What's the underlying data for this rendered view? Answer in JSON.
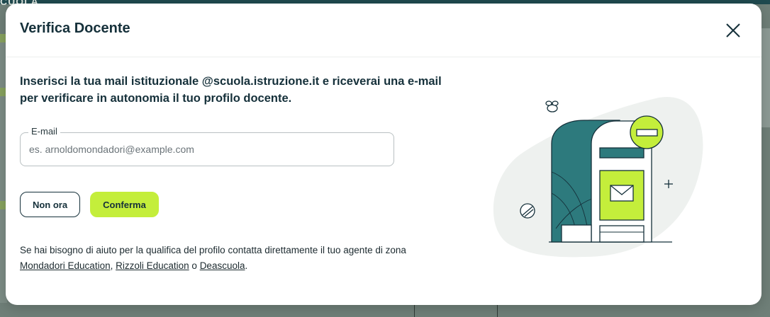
{
  "background": {
    "brand_text": "CUOLA"
  },
  "modal": {
    "title": "Verifica Docente",
    "intro": "Inserisci la tua mail istituzionale @scuola.istruzione.it e riceverai una e-mail per verificare in autonomia il tuo profilo docente.",
    "email_label": "E-mail",
    "email_placeholder": "es. arnoldomondadori@example.com",
    "email_value": "",
    "btn_cancel": "Non ora",
    "btn_confirm": "Conferma",
    "help_prefix": "Se hai bisogno di aiuto per la qualifica del profilo contatta direttamente il tuo agente di zona ",
    "help_link_1": "Mondadori Education",
    "help_sep_1": ", ",
    "help_link_2": "Rizzoli Education",
    "help_sep_2": " o ",
    "help_link_3": "Deascuola",
    "help_suffix": "."
  },
  "icons": {
    "close": "close-icon",
    "illustration": "mailbox-illustration"
  },
  "colors": {
    "accent": "#c4ee3b",
    "text_dark": "#15303a",
    "teal": "#2d7a7d",
    "blob": "#eef1ef"
  }
}
